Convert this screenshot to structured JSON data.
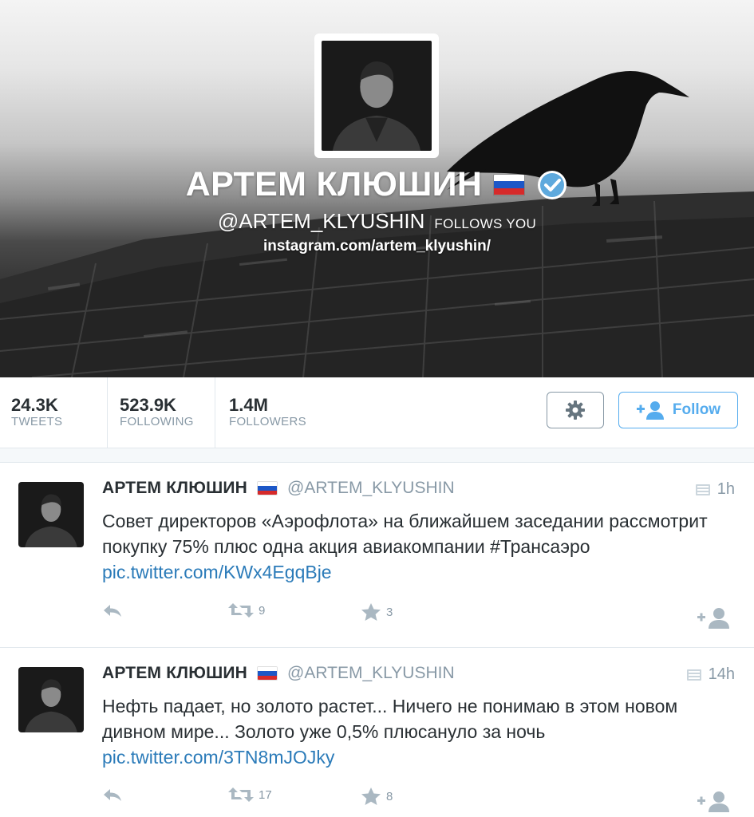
{
  "profile": {
    "name": "АРТЕМ КЛЮШИН",
    "handle": "@ARTEM_KLYUSHIN",
    "follows_you": "FOLLOWS YOU",
    "url": "instagram.com/artem_klyushin/",
    "flag_icon": "russia-flag-icon",
    "verified_icon": "verified-badge-icon"
  },
  "stats": {
    "tweets": {
      "value": "24.3K",
      "label": "TWEETS"
    },
    "following": {
      "value": "523.9K",
      "label": "FOLLOWING"
    },
    "followers": {
      "value": "1.4M",
      "label": "FOLLOWERS"
    }
  },
  "actions": {
    "gear_icon": "gear-icon",
    "follow_label": "Follow"
  },
  "tweets": [
    {
      "author": "АРТЕМ КЛЮШИН",
      "handle": "@ARTEM_KLYUSHIN",
      "time": "1h",
      "text": "Совет директоров «Аэрофлота» на ближайшем заседании рассмотрит покупку 75% плюс одна акция авиакомпании #Трансаэро ",
      "link": "pic.twitter.com/KWx4EgqBje",
      "retweets": "9",
      "favorites": "3"
    },
    {
      "author": "АРТЕМ КЛЮШИН",
      "handle": "@ARTEM_KLYUSHIN",
      "time": "14h",
      "text": "Нефть падает,  но золото растет... Ничего не понимаю в этом новом дивном мире... Золото уже 0,5% плюсануло за ночь",
      "link": "pic.twitter.com/3TN8mJOJky",
      "retweets": "17",
      "favorites": "8"
    }
  ],
  "colors": {
    "accent": "#55acee",
    "link": "#2b7bb9",
    "muted": "#8899a6",
    "text": "#292f33"
  }
}
